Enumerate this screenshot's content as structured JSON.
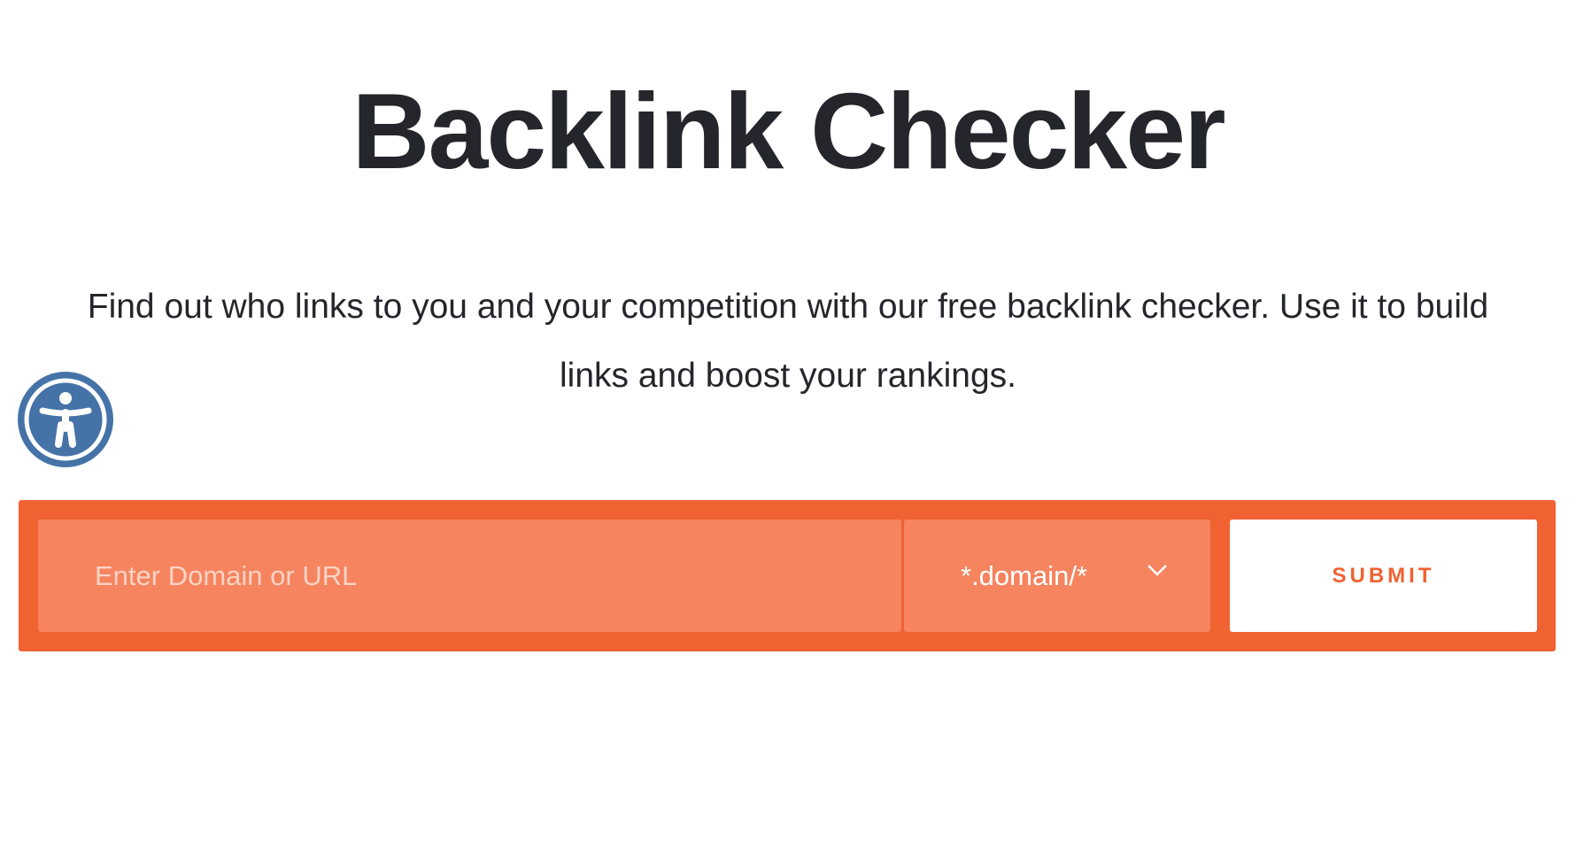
{
  "header": {
    "title": "Backlink Checker"
  },
  "description": {
    "line1": "Find out who links to you and your competition with our free backlink checker. Use it to build",
    "line2": "links and boost your rankings."
  },
  "accessibility": {
    "icon": "accessibility-icon"
  },
  "form": {
    "input_placeholder": "Enter Domain or URL",
    "input_value": "",
    "mode_selected": "*.domain/*",
    "submit_label": "SUBMIT"
  },
  "colors": {
    "accent": "#f06232",
    "field": "#f5845f",
    "title": "#25262b",
    "a11y": "#4573a8"
  }
}
